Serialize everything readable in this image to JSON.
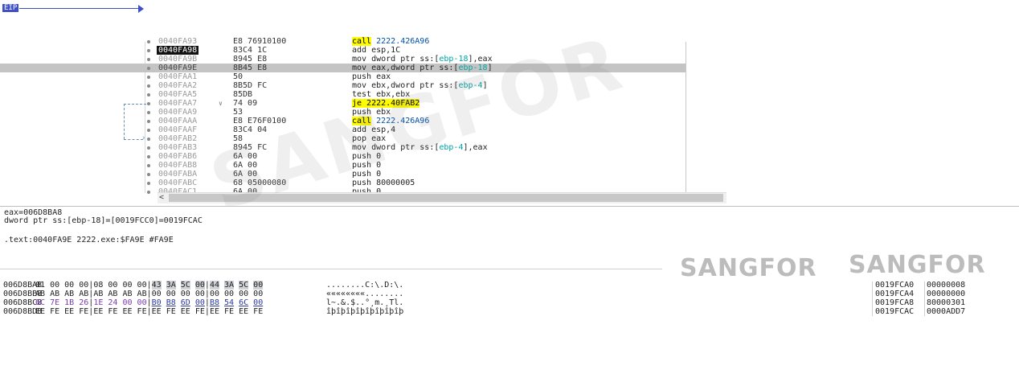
{
  "disasm": {
    "eip_label": "EIP",
    "partial_top_row": {
      "address": "0040FA93",
      "bytes": "E8 76910100",
      "instr": "call 2222.426A96"
    },
    "rows": [
      {
        "address": "0040FA98",
        "bytes": "83C4 1C",
        "instr": "add esp,1C"
      },
      {
        "address": "0040FA9B",
        "bytes": "8945 E8",
        "instr": "mov dword ptr ss:[ebp-18],eax"
      },
      {
        "address": "0040FA9E",
        "bytes": "8B45 E8",
        "instr": "mov eax,dword ptr ss:[ebp-18]"
      },
      {
        "address": "0040FAA1",
        "bytes": "50",
        "instr": "push eax"
      },
      {
        "address": "0040FAA2",
        "bytes": "8B5D FC",
        "instr": "mov ebx,dword ptr ss:[ebp-4]"
      },
      {
        "address": "0040FAA5",
        "bytes": "85DB",
        "instr": "test ebx,ebx"
      },
      {
        "address": "0040FAA7",
        "bytes": "74 09",
        "instr": "je 2222.40FAB2"
      },
      {
        "address": "0040FAA9",
        "bytes": "53",
        "instr": "push ebx"
      },
      {
        "address": "0040FAAA",
        "bytes": "E8 E76F0100",
        "instr": "call 2222.426A96"
      },
      {
        "address": "0040FAAF",
        "bytes": "83C4 04",
        "instr": "add esp,4"
      },
      {
        "address": "0040FAB2",
        "bytes": "58",
        "instr": "pop eax"
      },
      {
        "address": "0040FAB3",
        "bytes": "8945 FC",
        "instr": "mov dword ptr ss:[ebp-4],eax"
      },
      {
        "address": "0040FAB6",
        "bytes": "6A 00",
        "instr": "push 0"
      },
      {
        "address": "0040FAB8",
        "bytes": "6A 00",
        "instr": "push 0"
      },
      {
        "address": "0040FABA",
        "bytes": "6A 00",
        "instr": "push 0"
      },
      {
        "address": "0040FABC",
        "bytes": "68 05000080",
        "instr": "push 80000005"
      },
      {
        "address": "0040FAC1",
        "bytes": "6A 00",
        "instr": "push 0"
      }
    ]
  },
  "info": {
    "line1": "eax=006D8BA8",
    "line2": "dword ptr ss:[ebp-18]=[0019FCC0]=0019FCAC",
    "line3": ".text:0040FA9E 2222.exe:$FA9E #FA9E"
  },
  "dump": {
    "rows": [
      {
        "address": "006D8BA8",
        "hex": [
          "01",
          "00",
          "00",
          "00",
          "08",
          "00",
          "00",
          "00",
          "43",
          "3A",
          "5C",
          "00",
          "44",
          "3A",
          "5C",
          "00"
        ],
        "ascii": "........C:\\.D:\\."
      },
      {
        "address": "006D8BB8",
        "hex": [
          "AB",
          "AB",
          "AB",
          "AB",
          "AB",
          "AB",
          "AB",
          "AB",
          "00",
          "00",
          "00",
          "00",
          "00",
          "00",
          "00",
          "00"
        ],
        "ascii": "««««««««........"
      },
      {
        "address": "006D8BC8",
        "hex": [
          "6C",
          "7E",
          "1B",
          "26",
          "1E",
          "24",
          "00",
          "00",
          "B0",
          "B8",
          "6D",
          "00",
          "B8",
          "54",
          "6C",
          "00"
        ],
        "ascii": "l~.&.$..°¸m.¸Tl."
      },
      {
        "address": "006D8BD8",
        "hex": [
          "EE",
          "FE",
          "EE",
          "FE",
          "EE",
          "FE",
          "EE",
          "FE",
          "EE",
          "FE",
          "EE",
          "FE",
          "EE",
          "FE",
          "EE",
          "FE"
        ],
        "ascii": "îþîþîþîþîþîþîþîþ"
      }
    ]
  },
  "stack": {
    "rows": [
      {
        "address": "0019FCA0",
        "value": "00000008"
      },
      {
        "address": "0019FCA4",
        "value": "00000000"
      },
      {
        "address": "0019FCA8",
        "value": "80000301"
      },
      {
        "address": "0019FCAC",
        "value": "0000ADD7"
      }
    ]
  },
  "watermarks": {
    "big": "SANGFOR",
    "small_1": "SANGFOR",
    "small_2": "SANGFOR"
  },
  "colors": {
    "eip": "#3f4fc8",
    "current_row": "#c4c4c4",
    "branch_highlight": "#fffb00",
    "register_ref": "#00a4a4"
  }
}
